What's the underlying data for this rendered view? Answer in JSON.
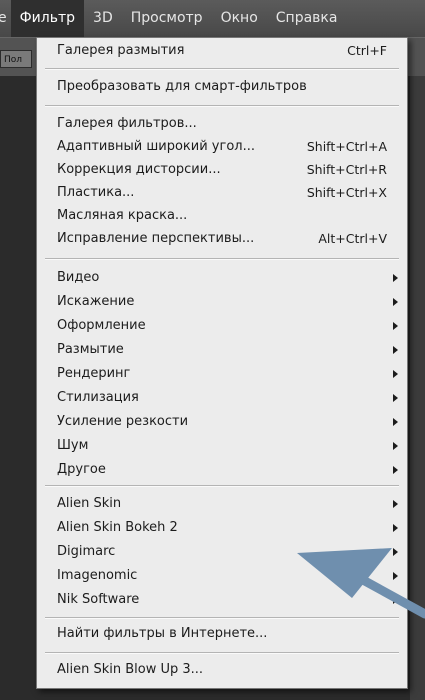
{
  "menubar": {
    "items": [
      {
        "label": "е",
        "state": "cut"
      },
      {
        "label": "Фильтр",
        "state": "active"
      },
      {
        "label": "3D",
        "state": "normal"
      },
      {
        "label": "Просмотр",
        "state": "normal"
      },
      {
        "label": "Окно",
        "state": "normal"
      },
      {
        "label": "Справка",
        "state": "normal"
      }
    ]
  },
  "optionsbar": {
    "field_text": "Пол"
  },
  "filter_menu": {
    "items": [
      {
        "label": "Галерея размытия",
        "shortcut": "Ctrl+F"
      },
      {
        "label": "Преобразовать для смарт-фильтров",
        "shortcut": ""
      },
      {
        "label": "Галерея фильтров...",
        "shortcut": ""
      },
      {
        "label": "Адаптивный широкий угол...",
        "shortcut": "Shift+Ctrl+A"
      },
      {
        "label": "Коррекция дисторсии...",
        "shortcut": "Shift+Ctrl+R"
      },
      {
        "label": "Пластика...",
        "shortcut": "Shift+Ctrl+X"
      },
      {
        "label": "Масляная краска...",
        "shortcut": ""
      },
      {
        "label": "Исправление перспективы...",
        "shortcut": "Alt+Ctrl+V"
      },
      {
        "label": "Видео",
        "submenu": true
      },
      {
        "label": "Искажение",
        "submenu": true
      },
      {
        "label": "Оформление",
        "submenu": true
      },
      {
        "label": "Размытие",
        "submenu": true
      },
      {
        "label": "Рендеринг",
        "submenu": true
      },
      {
        "label": "Стилизация",
        "submenu": true
      },
      {
        "label": "Усиление резкости",
        "submenu": true
      },
      {
        "label": "Шум",
        "submenu": true
      },
      {
        "label": "Другое",
        "submenu": true
      },
      {
        "label": "Alien Skin",
        "submenu": true
      },
      {
        "label": "Alien Skin Bokeh 2",
        "submenu": true
      },
      {
        "label": "Digimarc",
        "submenu": true
      },
      {
        "label": "Imagenomic",
        "submenu": true
      },
      {
        "label": "Nik Software",
        "submenu": true
      },
      {
        "label": "Найти фильтры в Интернете...",
        "shortcut": ""
      },
      {
        "label": "Alien Skin Blow Up 3...",
        "shortcut": ""
      }
    ]
  },
  "annotation": {
    "color": "#6f8fae",
    "icon": "pointer-arrow-icon"
  }
}
